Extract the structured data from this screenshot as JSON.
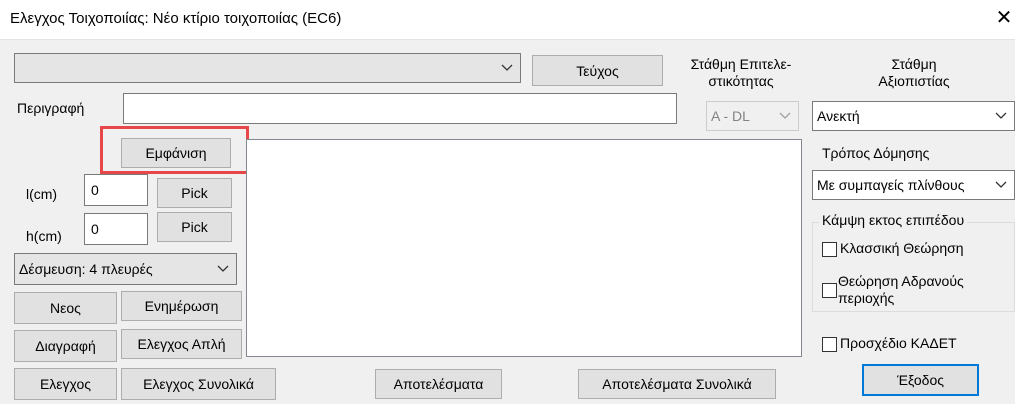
{
  "window": {
    "title": "Ελεγχος Τοιχοποιίας: Νέο κτίριο τοιχοποιίας (EC6)"
  },
  "top": {
    "combo_value": "",
    "tefxos_label": "Τεύχος"
  },
  "performance": {
    "label_line1": "Στάθμη Επιτελε-",
    "label_line2": "στικότητας",
    "value": "A - DL"
  },
  "reliability": {
    "label_line1": "Στάθμη",
    "label_line2": "Αξιοπιστίας",
    "value": "Ανεκτή"
  },
  "description": {
    "label": "Περιγραφή",
    "value": ""
  },
  "display_button": "Εμφάνιση",
  "dimensions": {
    "l_label": "l(cm)",
    "l_value": "0",
    "h_label": "h(cm)",
    "h_value": "0",
    "pick_label": "Pick"
  },
  "constraint": {
    "value": "Δέσμευση: 4 πλευρές"
  },
  "actions": {
    "new": "Νεος",
    "update": "Ενημέρωση",
    "delete": "Διαγραφή",
    "check_simple": "Ελεγχος Απλή",
    "check": "Ελεγχος",
    "check_total": "Ελεγχος Συνολικά",
    "results": "Αποτελέσματα",
    "results_total": "Αποτελέσματα Συνολικά",
    "exit": "Έξοδος"
  },
  "construction": {
    "label": "Τρόπος Δόμησης",
    "value": "Με συμπαγείς πλίνθους"
  },
  "bending": {
    "legend": "Κάμψη εκτος επιπέδου",
    "classic": "Κλασσική Θεώρηση",
    "inert_line1": "Θεώρηση Αδρανούς",
    "inert_line2": "περιοχής"
  },
  "draft": {
    "label": "Προσχέδιο ΚΑΔΕΤ"
  },
  "colors": {
    "highlight": "#e8474a",
    "default_button_border": "#0078d7"
  }
}
